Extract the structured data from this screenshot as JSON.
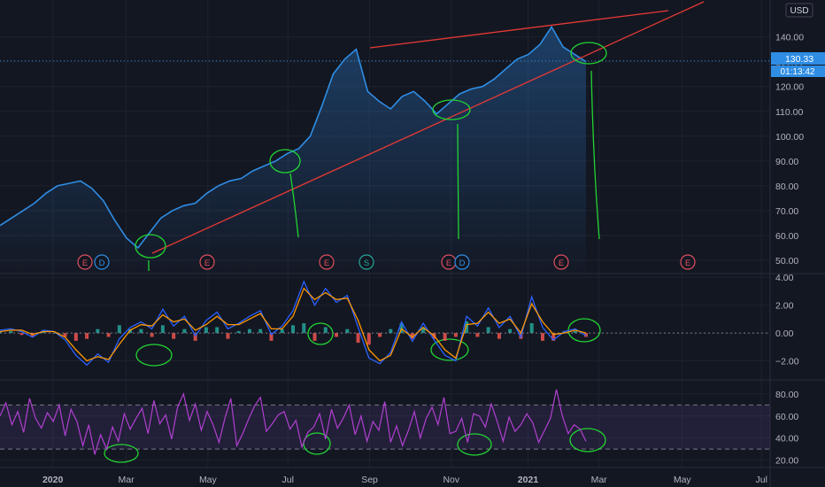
{
  "chart_data": [
    {
      "type": "line",
      "panel": "price",
      "currency": "USD",
      "ylim": [
        45,
        152
      ],
      "y_ticks": [
        "50.00",
        "60.00",
        "70.00",
        "80.00",
        "90.00",
        "100.00",
        "110.00",
        "120.00",
        "130.00",
        "140.00"
      ],
      "last_price": "130.33",
      "countdown": "01:13:42",
      "series": [
        {
          "values": [
            64,
            67,
            70,
            73,
            77,
            80,
            81,
            82,
            79,
            74,
            66,
            59,
            55,
            61,
            67,
            70,
            72,
            73,
            77,
            80,
            82,
            83,
            86,
            88,
            90,
            93,
            95,
            100,
            112,
            125,
            131,
            135,
            118,
            114,
            111,
            116,
            118,
            114,
            109,
            113,
            117,
            119,
            120,
            123,
            127,
            131,
            133,
            137,
            144,
            136,
            133,
            130
          ]
        }
      ],
      "events": [
        "E",
        "D",
        "E",
        "E",
        "S",
        "E",
        "D",
        "E",
        "E"
      ],
      "x_ticks": [
        "2020",
        "Mar",
        "May",
        "Jul",
        "Sep",
        "Nov",
        "2021",
        "Mar",
        "May",
        "Jul"
      ],
      "grid": true
    },
    {
      "type": "line",
      "panel": "macd",
      "ylim": [
        -3.3,
        4.2
      ],
      "y_ticks": [
        "4.00",
        "2.00",
        "0.00",
        "−2.00"
      ],
      "series": [
        {
          "color": "#2962ff",
          "values": [
            0.2,
            0.3,
            0.1,
            -0.3,
            0.2,
            0.1,
            -0.5,
            -1.6,
            -2.3,
            -1.5,
            -2.1,
            -0.4,
            0.4,
            0.8,
            0.3,
            1.7,
            0.5,
            1.2,
            -0.2,
            0.9,
            1.5,
            0.3,
            0.7,
            1.2,
            1.6,
            -0.1,
            0.5,
            1.6,
            3.7,
            2.0,
            3.2,
            2.2,
            2.7,
            0.4,
            -1.8,
            -2.2,
            -1.4,
            0.8,
            -0.6,
            0.7,
            -0.5,
            -1.6,
            -2.0,
            1.2,
            0.5,
            1.8,
            0.4,
            1.2,
            -0.3,
            2.6,
            0.4,
            -0.5,
            0.1,
            0.3,
            -0.2
          ]
        },
        {
          "color": "#ff9800",
          "values": [
            0.1,
            0.2,
            0.2,
            -0.1,
            0.1,
            0.1,
            -0.3,
            -1.2,
            -2.0,
            -1.7,
            -1.9,
            -0.8,
            0.2,
            0.6,
            0.5,
            1.3,
            0.8,
            1.0,
            0.2,
            0.6,
            1.2,
            0.6,
            0.6,
            1.0,
            1.4,
            0.3,
            0.3,
            1.2,
            3.2,
            2.4,
            2.9,
            2.4,
            2.5,
            0.9,
            -1.2,
            -2.0,
            -1.6,
            0.3,
            -0.3,
            0.4,
            -0.2,
            -1.2,
            -1.8,
            0.6,
            0.7,
            1.5,
            0.7,
            1.0,
            0.0,
            2.1,
            0.8,
            -0.1,
            0.0,
            0.2,
            0.0
          ]
        }
      ]
    },
    {
      "type": "line",
      "panel": "rsi",
      "color": "#9c27b0",
      "ylim": [
        14,
        92
      ],
      "y_ticks": [
        "80.00",
        "60.00",
        "40.00",
        "20.00"
      ],
      "bands": [
        70,
        30
      ],
      "series": [
        {
          "values": [
            60,
            72,
            52,
            64,
            45,
            76,
            58,
            49,
            63,
            55,
            70,
            42,
            66,
            55,
            33,
            52,
            25,
            43,
            30,
            50,
            37,
            62,
            48,
            58,
            67,
            44,
            74,
            53,
            61,
            39,
            68,
            80,
            56,
            71,
            47,
            64,
            52,
            36,
            58,
            76,
            33,
            44,
            57,
            69,
            77,
            46,
            53,
            61,
            64,
            48,
            56,
            32,
            45,
            50,
            62,
            39,
            66,
            49,
            58,
            70,
            43,
            60,
            37,
            55,
            47,
            73,
            36,
            51,
            33,
            47,
            64,
            40,
            58,
            68,
            52,
            77,
            44,
            46,
            58,
            36,
            62,
            60,
            50,
            71,
            55,
            37,
            59,
            46,
            52,
            62,
            54,
            36,
            47,
            58,
            84,
            60,
            44,
            52,
            48,
            37
          ]
        }
      ]
    }
  ]
}
